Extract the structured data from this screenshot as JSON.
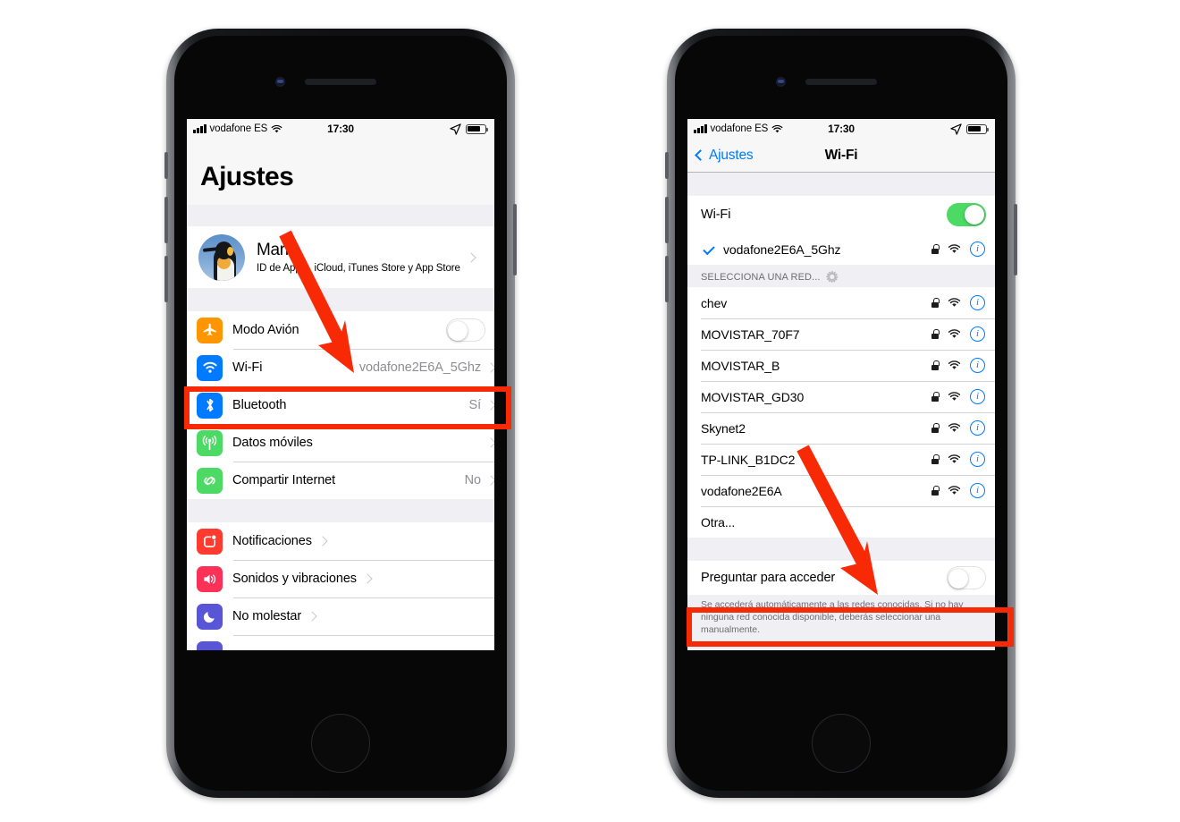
{
  "accent": {
    "red": "#f82a06",
    "blue": "#007aff",
    "green": "#4cd964",
    "gray": "#8e8e93"
  },
  "status_bar": {
    "carrier": "vodafone ES",
    "time": "17:30",
    "signal_icon": "cellular-bars-icon",
    "wifi_icon": "wifi-icon",
    "location_icon": "location-arrow-icon",
    "battery_icon": "battery-icon"
  },
  "left_phone": {
    "title": "Ajustes",
    "account": {
      "name": "Mario",
      "subtitle": "ID de Apple, iCloud, iTunes Store y App Store",
      "avatar": "penguin-avatar"
    },
    "group1": [
      {
        "label": "Modo Avión",
        "icon": "airplane-icon",
        "icon_color": "#ff9500",
        "control": "toggle",
        "toggle_on": false
      },
      {
        "label": "Wi-Fi",
        "icon": "wifi-icon",
        "icon_color": "#007aff",
        "value": "vodafone2E6A_5Ghz",
        "control": "chevron",
        "highlighted": true
      },
      {
        "label": "Bluetooth",
        "icon": "bluetooth-icon",
        "icon_color": "#007aff",
        "value": "Sí",
        "control": "chevron"
      },
      {
        "label": "Datos móviles",
        "icon": "cellular-icon",
        "icon_color": "#4cd964",
        "value": "",
        "control": "chevron"
      },
      {
        "label": "Compartir Internet",
        "icon": "hotspot-icon",
        "icon_color": "#4cd964",
        "value": "No",
        "control": "chevron"
      }
    ],
    "group2": [
      {
        "label": "Notificaciones",
        "icon": "notifications-icon",
        "icon_color": "#ff3b30",
        "control": "chevron"
      },
      {
        "label": "Sonidos y vibraciones",
        "icon": "sounds-icon",
        "icon_color": "#fc3158",
        "control": "chevron"
      },
      {
        "label": "No molestar",
        "icon": "moon-icon",
        "icon_color": "#5856d6",
        "control": "chevron"
      }
    ]
  },
  "right_phone": {
    "nav": {
      "back_label": "Ajustes",
      "title": "Wi-Fi",
      "back_icon": "chevron-left-icon"
    },
    "wifi_toggle": {
      "label": "Wi-Fi",
      "on": true
    },
    "connected_network": {
      "name": "vodafone2E6A_5Ghz",
      "checked": true,
      "lock_icon": "lock-icon",
      "signal_icon": "wifi-icon",
      "info_icon": "info-circle-icon"
    },
    "section_header": "SELECCIONA UNA RED...",
    "section_spinner": "loading-spinner-icon",
    "networks": [
      {
        "name": "chev",
        "secured": true
      },
      {
        "name": "MOVISTAR_70F7",
        "secured": true
      },
      {
        "name": "MOVISTAR_B",
        "secured": true
      },
      {
        "name": "MOVISTAR_GD30",
        "secured": true
      },
      {
        "name": "Skynet2",
        "secured": true
      },
      {
        "name": "TP-LINK_B1DC2",
        "secured": true
      },
      {
        "name": "vodafone2E6A",
        "secured": true
      }
    ],
    "other_network": "Otra...",
    "ask_to_join": {
      "label": "Preguntar para acceder",
      "on": false,
      "highlighted": true
    },
    "footnote": "Se accederá automáticamente a las redes conocidas. Si no hay ninguna red conocida disponible, deberás seleccionar una manualmente."
  }
}
